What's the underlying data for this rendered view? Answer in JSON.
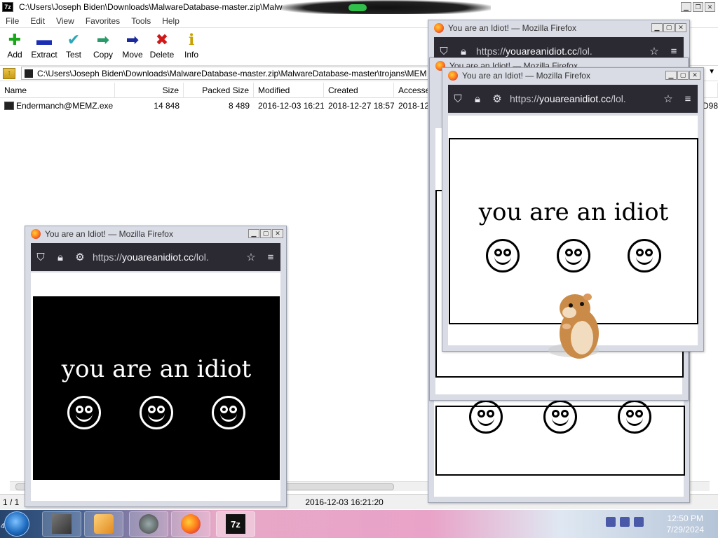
{
  "zip": {
    "title": "C:\\Users\\Joseph Biden\\Downloads\\MalwareDatabase-master.zip\\Malw",
    "app_icon_text": "7z",
    "menu": [
      "File",
      "Edit",
      "View",
      "Favorites",
      "Tools",
      "Help"
    ],
    "toolbar": [
      {
        "label": "Add",
        "icon": "plus-icon",
        "glyph": "✚",
        "color": "#1aa61a"
      },
      {
        "label": "Extract",
        "icon": "minus-icon",
        "glyph": "▬",
        "color": "#1b2fb5"
      },
      {
        "label": "Test",
        "icon": "check-icon",
        "glyph": "✔",
        "color": "#2aa7b8"
      },
      {
        "label": "Copy",
        "icon": "arrow-right-icon",
        "glyph": "➡",
        "color": "#2a9a6a"
      },
      {
        "label": "Move",
        "icon": "arrow-right-icon",
        "glyph": "➡",
        "color": "#1b2a9a"
      },
      {
        "label": "Delete",
        "icon": "delete-x-icon",
        "glyph": "✖",
        "color": "#d01818"
      },
      {
        "label": "Info",
        "icon": "info-icon",
        "glyph": "ℹ",
        "color": "#c9a100"
      }
    ],
    "address": "C:\\Users\\Joseph Biden\\Downloads\\MalwareDatabase-master.zip\\MalwareDatabase-master\\trojans\\MEM",
    "columns": [
      "Name",
      "Size",
      "Packed Size",
      "Modified",
      "Created",
      "Accesse"
    ],
    "row": {
      "name": "Endermanch@MEMZ.exe",
      "size": "14 848",
      "packed": "8 489",
      "modified": "2016-12-03 16:21",
      "created": "2018-12-27 18:57",
      "accessed": "2018-12",
      "trail": "D98"
    },
    "status": {
      "selection": "1 / 1",
      "date": "2016-12-03 16:21:20"
    }
  },
  "firefox": {
    "window_title": "You are an Idiot! — Mozilla Firefox",
    "url_prefix": "https://",
    "url_domain": "youareanidiot.cc",
    "url_suffix": "/lol.",
    "page_text": "you are an idiot"
  },
  "taskbar": {
    "time": "12:50 PM",
    "date": "7/29/2024",
    "start_label": "4"
  }
}
